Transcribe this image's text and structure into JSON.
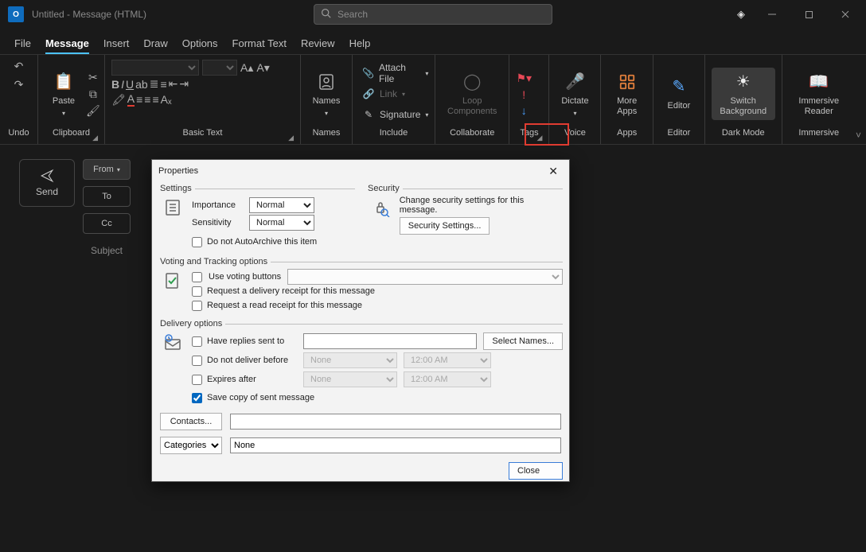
{
  "window": {
    "title": "Untitled  -  Message (HTML)",
    "search_placeholder": "Search"
  },
  "tabs": {
    "file": "File",
    "message": "Message",
    "insert": "Insert",
    "draw": "Draw",
    "options": "Options",
    "format_text": "Format Text",
    "review": "Review",
    "help": "Help"
  },
  "ribbon": {
    "undo": "Undo",
    "clipboard": "Clipboard",
    "paste": "Paste",
    "basic_text": "Basic Text",
    "names": "Names",
    "include": "Include",
    "attach_file": "Attach File",
    "link": "Link",
    "signature": "Signature",
    "collaborate": "Collaborate",
    "loop": "Loop Components",
    "tags": "Tags",
    "voice": "Voice",
    "dictate": "Dictate",
    "apps": "Apps",
    "more_apps": "More Apps",
    "editor": "Editor",
    "editor_btn": "Editor",
    "dark_mode": "Dark Mode",
    "switch_bg": "Switch Background",
    "immersive": "Immersive",
    "immersive_reader": "Immersive Reader"
  },
  "compose": {
    "send": "Send",
    "from": "From",
    "to": "To",
    "cc": "Cc",
    "subject": "Subject"
  },
  "dialog": {
    "title": "Properties",
    "settings_legend": "Settings",
    "importance_label": "Importance",
    "importance_value": "Normal",
    "sensitivity_label": "Sensitivity",
    "sensitivity_value": "Normal",
    "no_autoarchive": "Do not AutoArchive this item",
    "security_legend": "Security",
    "security_text": "Change security settings for this message.",
    "security_settings_btn": "Security Settings...",
    "vt_legend": "Voting and Tracking options",
    "use_voting": "Use voting buttons",
    "req_delivery": "Request a delivery receipt for this message",
    "req_read": "Request a read receipt for this message",
    "delivery_legend": "Delivery options",
    "replies_sent_to": "Have replies sent to",
    "select_names_btn": "Select Names...",
    "no_deliver_before": "Do not deliver before",
    "none": "None",
    "time_default": "12:00 AM",
    "expires_after": "Expires after",
    "save_copy": "Save copy of sent message",
    "contacts_btn": "Contacts...",
    "categories_btn": "Categories",
    "categories_value": "None",
    "close_btn": "Close"
  }
}
